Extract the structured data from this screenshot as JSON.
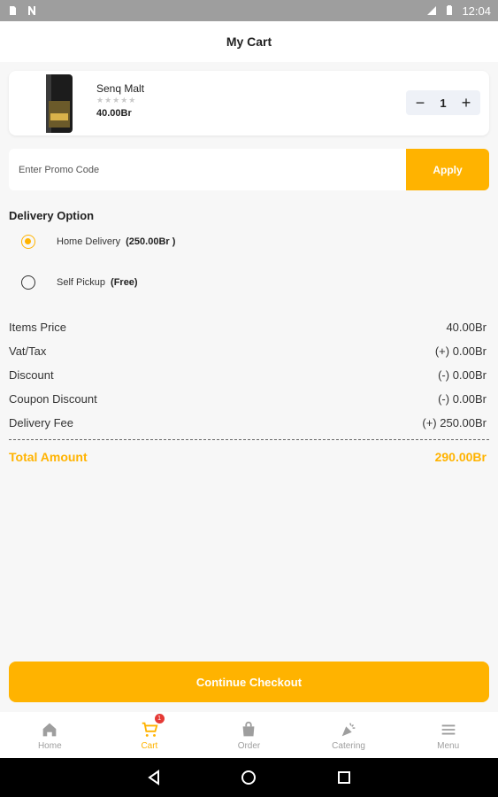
{
  "status_bar": {
    "time": "12:04",
    "left_icons": [
      "sd-card-icon",
      "n-icon"
    ],
    "right_icons": [
      "signal-icon",
      "battery-icon"
    ]
  },
  "app_bar": {
    "title": "My Cart"
  },
  "cart_items": [
    {
      "name": "Senq Malt",
      "rating": "★★★★★",
      "price": "40.00Br",
      "quantity": "1"
    }
  ],
  "promo": {
    "placeholder": "Enter Promo Code",
    "apply_label": "Apply"
  },
  "delivery": {
    "title": "Delivery Option",
    "options": [
      {
        "label": "Home Delivery",
        "extra": "(250.00Br )",
        "selected": true
      },
      {
        "label": "Self Pickup",
        "extra": "(Free)",
        "selected": false
      }
    ]
  },
  "summary": [
    {
      "label": "Items Price",
      "value": "40.00Br"
    },
    {
      "label": "Vat/Tax",
      "value": "(+) 0.00Br"
    },
    {
      "label": "Discount",
      "value": "(-) 0.00Br"
    },
    {
      "label": "Coupon Discount",
      "value": "(-) 0.00Br"
    },
    {
      "label": "Delivery Fee",
      "value": "(+) 250.00Br"
    }
  ],
  "total": {
    "label": "Total Amount",
    "value": "290.00Br"
  },
  "checkout": {
    "label": "Continue Checkout"
  },
  "bottom_nav": {
    "items": [
      {
        "label": "Home",
        "icon": "home-icon"
      },
      {
        "label": "Cart",
        "icon": "cart-icon",
        "badge": "1",
        "active": true
      },
      {
        "label": "Order",
        "icon": "bag-icon"
      },
      {
        "label": "Catering",
        "icon": "party-icon"
      },
      {
        "label": "Menu",
        "icon": "menu-icon"
      }
    ]
  },
  "colors": {
    "accent": "#ffb300",
    "badge": "#e53935"
  }
}
